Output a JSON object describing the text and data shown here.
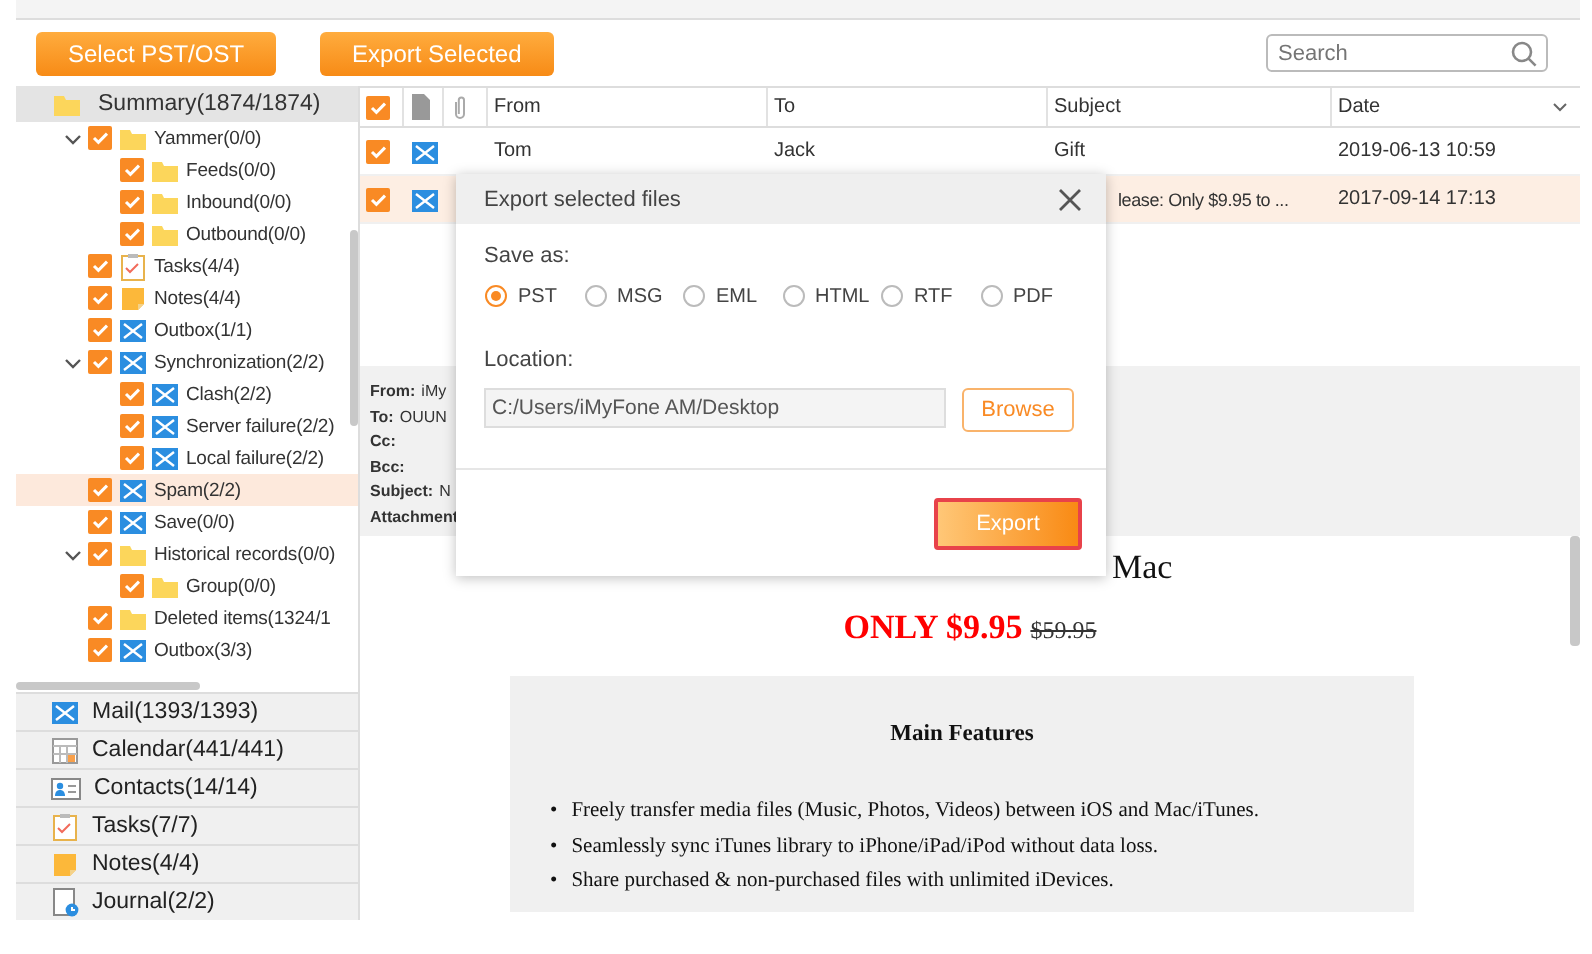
{
  "toolbar": {
    "buttons": [
      "Select PST/OST",
      "Export Selected"
    ],
    "search": {
      "placeholder": "Search"
    }
  },
  "tree": {
    "label": "Summary(1874/1874)",
    "children": [
      {
        "label": "Yammer(0/0)",
        "kind": "folder",
        "checked": true,
        "selected": false,
        "expanded": true,
        "children": [
          {
            "label": "Feeds(0/0)",
            "kind": "folder",
            "checked": true,
            "selected": false
          },
          {
            "label": "Inbound(0/0)",
            "kind": "folder",
            "checked": true,
            "selected": false
          },
          {
            "label": "Outbound(0/0)",
            "kind": "folder",
            "checked": true,
            "selected": false
          }
        ]
      },
      {
        "label": "Tasks(4/4)",
        "kind": "tasks",
        "checked": true,
        "selected": false
      },
      {
        "label": "Notes(4/4)",
        "kind": "notes",
        "checked": true,
        "selected": false
      },
      {
        "label": "Outbox(1/1)",
        "kind": "mail",
        "checked": true,
        "selected": false
      },
      {
        "label": "Synchronization(2/2)",
        "kind": "mail",
        "checked": true,
        "selected": false,
        "expanded": true,
        "children": [
          {
            "label": "Clash(2/2)",
            "kind": "mail",
            "checked": true,
            "selected": false
          },
          {
            "label": "Server failure(2/2)",
            "kind": "mail",
            "checked": true,
            "selected": false
          },
          {
            "label": "Local failure(2/2)",
            "kind": "mail",
            "checked": true,
            "selected": false
          }
        ]
      },
      {
        "label": "Spam(2/2)",
        "kind": "mail",
        "checked": true,
        "selected": true
      },
      {
        "label": "Save(0/0)",
        "kind": "mail",
        "checked": true,
        "selected": false
      },
      {
        "label": "Historical records(0/0)",
        "kind": "folder",
        "checked": true,
        "selected": false,
        "expanded": true,
        "children": [
          {
            "label": "Group(0/0)",
            "kind": "folder",
            "checked": true,
            "selected": false
          }
        ]
      },
      {
        "label": "Deleted items(1324/1",
        "kind": "folder",
        "checked": true,
        "selected": false
      },
      {
        "label": "Outbox(3/3)",
        "kind": "mail",
        "checked": true,
        "selected": false
      }
    ]
  },
  "nav": [
    {
      "label": "Mail(1393/1393)",
      "kind": "mail"
    },
    {
      "label": "Calendar(441/441)",
      "kind": "calendar"
    },
    {
      "label": "Contacts(14/14)",
      "kind": "contacts"
    },
    {
      "label": "Tasks(7/7)",
      "kind": "tasks"
    },
    {
      "label": "Notes(4/4)",
      "kind": "notes"
    },
    {
      "label": "Journal(2/2)",
      "kind": "journal"
    }
  ],
  "table": {
    "all_checked": true,
    "columns": [
      "From",
      "To",
      "Subject",
      "Date"
    ],
    "rows": [
      {
        "checked": true,
        "selected": false,
        "from": "Tom",
        "to": "Jack",
        "subject": "Gift",
        "date": "2019-06-13 10:59"
      },
      {
        "checked": true,
        "selected": true,
        "subject": "lease: Only $9.95 to ...",
        "date": "2017-09-14 17:13"
      }
    ]
  },
  "preview": {
    "fields": [
      {
        "label": "From:",
        "value": "iMy"
      },
      {
        "label": "To:",
        "value": "OUUN"
      },
      {
        "label": "Cc:"
      },
      {
        "label": "Bcc:"
      },
      {
        "label": "Subject:",
        "value": "N"
      },
      {
        "label": "Attachment"
      }
    ],
    "heading": "Mac",
    "bullet": "•",
    "price": "ONLY $9.95",
    "old_price": "$59.95",
    "features_title": "Main Features",
    "features": [
      "Freely transfer media files (Music, Photos, Videos) between iOS and Mac/iTunes.",
      "Seamlessly sync iTunes library to iPhone/iPad/iPod without data loss.",
      "Share purchased & non-purchased files with unlimited iDevices."
    ]
  },
  "dialog": {
    "title": "Export selected files",
    "save_as_label": "Save as:",
    "formats": [
      {
        "label": "PST",
        "selected": true
      },
      {
        "label": "MSG",
        "selected": false
      },
      {
        "label": "EML",
        "selected": false
      },
      {
        "label": "HTML",
        "selected": false
      },
      {
        "label": "RTF",
        "selected": false
      },
      {
        "label": "PDF",
        "selected": false
      }
    ],
    "location_label": "Location:",
    "location": "C:/Users/iMyFone AM/Desktop",
    "browse": "Browse",
    "export": "Export",
    "export_highlighted": true
  }
}
